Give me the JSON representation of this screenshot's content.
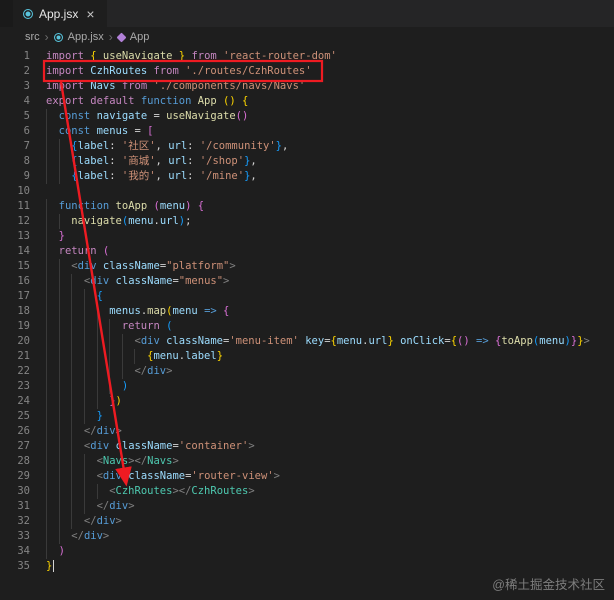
{
  "window": {
    "tab_title": "App.jsx",
    "close_glyph": "×",
    "breadcrumb": {
      "items": [
        "src",
        "App.jsx",
        "App"
      ],
      "chevron": "›"
    }
  },
  "annotation": {
    "color": "#ee1b22"
  },
  "watermark": "@稀土掘金技术社区",
  "editor": {
    "cursor_line": 35,
    "lines": [
      {
        "n": 1,
        "indent": 0,
        "tokens": [
          [
            "k",
            "import "
          ],
          [
            "g",
            "{ "
          ],
          [
            "f",
            "useNavigate"
          ],
          [
            "g",
            " }"
          ],
          [
            "k",
            " from "
          ],
          [
            "s",
            "'react-router-dom'"
          ]
        ]
      },
      {
        "n": 2,
        "indent": 0,
        "tokens": [
          [
            "k",
            "import "
          ],
          [
            "v",
            "CzhRoutes"
          ],
          [
            "k",
            " from "
          ],
          [
            "s",
            "'./routes/CzhRoutes'"
          ]
        ]
      },
      {
        "n": 3,
        "indent": 0,
        "tokens": [
          [
            "k",
            "import "
          ],
          [
            "v",
            "Navs"
          ],
          [
            "k",
            " from "
          ],
          [
            "s",
            "'./components/navs/Navs'"
          ]
        ]
      },
      {
        "n": 4,
        "indent": 0,
        "tokens": [
          [
            "k",
            "export default "
          ],
          [
            "c",
            "function "
          ],
          [
            "f",
            "App"
          ],
          [
            "p",
            " "
          ],
          [
            "g",
            "()"
          ],
          [
            "p",
            " "
          ],
          [
            "g",
            "{"
          ]
        ]
      },
      {
        "n": 5,
        "indent": 1,
        "tokens": [
          [
            "c",
            "const "
          ],
          [
            "v",
            "navigate"
          ],
          [
            "p",
            " = "
          ],
          [
            "f",
            "useNavigate"
          ],
          [
            "m",
            "()"
          ]
        ]
      },
      {
        "n": 6,
        "indent": 1,
        "tokens": [
          [
            "c",
            "const "
          ],
          [
            "v",
            "menus"
          ],
          [
            "p",
            " = "
          ],
          [
            "m",
            "["
          ]
        ]
      },
      {
        "n": 7,
        "indent": 2,
        "tokens": [
          [
            "u",
            "{"
          ],
          [
            "v",
            "label"
          ],
          [
            "p",
            ": "
          ],
          [
            "s",
            "'社区'"
          ],
          [
            "p",
            ", "
          ],
          [
            "v",
            "url"
          ],
          [
            "p",
            ": "
          ],
          [
            "s",
            "'/community'"
          ],
          [
            "u",
            "}"
          ],
          [
            "p",
            ","
          ]
        ]
      },
      {
        "n": 8,
        "indent": 2,
        "tokens": [
          [
            "u",
            "{"
          ],
          [
            "v",
            "label"
          ],
          [
            "p",
            ": "
          ],
          [
            "s",
            "'商城'"
          ],
          [
            "p",
            ", "
          ],
          [
            "v",
            "url"
          ],
          [
            "p",
            ": "
          ],
          [
            "s",
            "'/shop'"
          ],
          [
            "u",
            "}"
          ],
          [
            "p",
            ","
          ]
        ]
      },
      {
        "n": 9,
        "indent": 2,
        "tokens": [
          [
            "u",
            "{"
          ],
          [
            "v",
            "label"
          ],
          [
            "p",
            ": "
          ],
          [
            "s",
            "'我的'"
          ],
          [
            "p",
            ", "
          ],
          [
            "v",
            "url"
          ],
          [
            "p",
            ": "
          ],
          [
            "s",
            "'/mine'"
          ],
          [
            "u",
            "}"
          ],
          [
            "p",
            ","
          ]
        ]
      },
      {
        "n": 10,
        "indent": 0,
        "tokens": []
      },
      {
        "n": 11,
        "indent": 1,
        "tokens": [
          [
            "c",
            "function "
          ],
          [
            "f",
            "toApp"
          ],
          [
            "p",
            " "
          ],
          [
            "m",
            "("
          ],
          [
            "v",
            "menu"
          ],
          [
            "m",
            ")"
          ],
          [
            "p",
            " "
          ],
          [
            "m",
            "{"
          ]
        ]
      },
      {
        "n": 12,
        "indent": 2,
        "tokens": [
          [
            "f",
            "navigate"
          ],
          [
            "u",
            "("
          ],
          [
            "v",
            "menu"
          ],
          [
            "p",
            "."
          ],
          [
            "v",
            "url"
          ],
          [
            "u",
            ")"
          ],
          [
            "p",
            ";"
          ]
        ]
      },
      {
        "n": 13,
        "indent": 1,
        "tokens": [
          [
            "m",
            "}"
          ]
        ]
      },
      {
        "n": 14,
        "indent": 1,
        "tokens": [
          [
            "k",
            "return"
          ],
          [
            "p",
            " "
          ],
          [
            "m",
            "("
          ]
        ]
      },
      {
        "n": 15,
        "indent": 2,
        "tokens": [
          [
            "a",
            "<"
          ],
          [
            "t",
            "div"
          ],
          [
            "p",
            " "
          ],
          [
            "v",
            "className"
          ],
          [
            "p",
            "="
          ],
          [
            "s",
            "\"platform\""
          ],
          [
            "a",
            ">"
          ]
        ]
      },
      {
        "n": 16,
        "indent": 3,
        "tokens": [
          [
            "a",
            "<"
          ],
          [
            "t",
            "div"
          ],
          [
            "p",
            " "
          ],
          [
            "v",
            "className"
          ],
          [
            "p",
            "="
          ],
          [
            "s",
            "\"menus\""
          ],
          [
            "a",
            ">"
          ]
        ]
      },
      {
        "n": 17,
        "indent": 4,
        "tokens": [
          [
            "u",
            "{"
          ]
        ]
      },
      {
        "n": 18,
        "indent": 5,
        "tokens": [
          [
            "v",
            "menus"
          ],
          [
            "p",
            "."
          ],
          [
            "f",
            "map"
          ],
          [
            "g",
            "("
          ],
          [
            "v",
            "menu"
          ],
          [
            "p",
            " "
          ],
          [
            "c",
            "=>"
          ],
          [
            "p",
            " "
          ],
          [
            "m",
            "{"
          ]
        ]
      },
      {
        "n": 19,
        "indent": 6,
        "tokens": [
          [
            "k",
            "return"
          ],
          [
            "p",
            " "
          ],
          [
            "u",
            "("
          ]
        ]
      },
      {
        "n": 20,
        "indent": 7,
        "tokens": [
          [
            "a",
            "<"
          ],
          [
            "t",
            "div"
          ],
          [
            "p",
            " "
          ],
          [
            "v",
            "className"
          ],
          [
            "p",
            "="
          ],
          [
            "s",
            "'menu-item'"
          ],
          [
            "p",
            " "
          ],
          [
            "v",
            "key"
          ],
          [
            "p",
            "="
          ],
          [
            "g",
            "{"
          ],
          [
            "v",
            "menu"
          ],
          [
            "p",
            "."
          ],
          [
            "v",
            "url"
          ],
          [
            "g",
            "}"
          ],
          [
            "p",
            " "
          ],
          [
            "v",
            "onClick"
          ],
          [
            "p",
            "="
          ],
          [
            "g",
            "{"
          ],
          [
            "m",
            "()"
          ],
          [
            "p",
            " "
          ],
          [
            "c",
            "=>"
          ],
          [
            "p",
            " "
          ],
          [
            "m",
            "{"
          ],
          [
            "f",
            "toApp"
          ],
          [
            "u",
            "("
          ],
          [
            "v",
            "menu"
          ],
          [
            "u",
            ")"
          ],
          [
            "m",
            "}"
          ],
          [
            "g",
            "}"
          ],
          [
            "a",
            ">"
          ]
        ]
      },
      {
        "n": 21,
        "indent": 8,
        "tokens": [
          [
            "g",
            "{"
          ],
          [
            "v",
            "menu"
          ],
          [
            "p",
            "."
          ],
          [
            "v",
            "label"
          ],
          [
            "g",
            "}"
          ]
        ]
      },
      {
        "n": 22,
        "indent": 7,
        "tokens": [
          [
            "a",
            "</"
          ],
          [
            "t",
            "div"
          ],
          [
            "a",
            ">"
          ]
        ]
      },
      {
        "n": 23,
        "indent": 6,
        "tokens": [
          [
            "u",
            ")"
          ]
        ]
      },
      {
        "n": 24,
        "indent": 5,
        "tokens": [
          [
            "m",
            "}"
          ],
          [
            "g",
            ")"
          ]
        ]
      },
      {
        "n": 25,
        "indent": 4,
        "tokens": [
          [
            "u",
            "}"
          ]
        ]
      },
      {
        "n": 26,
        "indent": 3,
        "tokens": [
          [
            "a",
            "</"
          ],
          [
            "t",
            "div"
          ],
          [
            "a",
            ">"
          ]
        ]
      },
      {
        "n": 27,
        "indent": 3,
        "tokens": [
          [
            "a",
            "<"
          ],
          [
            "t",
            "div"
          ],
          [
            "p",
            " "
          ],
          [
            "v",
            "className"
          ],
          [
            "p",
            "="
          ],
          [
            "s",
            "'container'"
          ],
          [
            "a",
            ">"
          ]
        ]
      },
      {
        "n": 28,
        "indent": 4,
        "tokens": [
          [
            "a",
            "<"
          ],
          [
            "e",
            "Navs"
          ],
          [
            "a",
            "></"
          ],
          [
            "e",
            "Navs"
          ],
          [
            "a",
            ">"
          ]
        ]
      },
      {
        "n": 29,
        "indent": 4,
        "tokens": [
          [
            "a",
            "<"
          ],
          [
            "t",
            "div"
          ],
          [
            "p",
            " "
          ],
          [
            "v",
            "className"
          ],
          [
            "p",
            "="
          ],
          [
            "s",
            "'router-view'"
          ],
          [
            "a",
            ">"
          ]
        ]
      },
      {
        "n": 30,
        "indent": 5,
        "tokens": [
          [
            "a",
            "<"
          ],
          [
            "e",
            "CzhRoutes"
          ],
          [
            "a",
            "></"
          ],
          [
            "e",
            "CzhRoutes"
          ],
          [
            "a",
            ">"
          ]
        ]
      },
      {
        "n": 31,
        "indent": 4,
        "tokens": [
          [
            "a",
            "</"
          ],
          [
            "t",
            "div"
          ],
          [
            "a",
            ">"
          ]
        ]
      },
      {
        "n": 32,
        "indent": 3,
        "tokens": [
          [
            "a",
            "</"
          ],
          [
            "t",
            "div"
          ],
          [
            "a",
            ">"
          ]
        ]
      },
      {
        "n": 33,
        "indent": 2,
        "tokens": [
          [
            "a",
            "</"
          ],
          [
            "t",
            "div"
          ],
          [
            "a",
            ">"
          ]
        ]
      },
      {
        "n": 34,
        "indent": 1,
        "tokens": [
          [
            "m",
            ")"
          ]
        ]
      },
      {
        "n": 35,
        "indent": 0,
        "tokens": [
          [
            "g",
            "}"
          ]
        ]
      }
    ]
  }
}
